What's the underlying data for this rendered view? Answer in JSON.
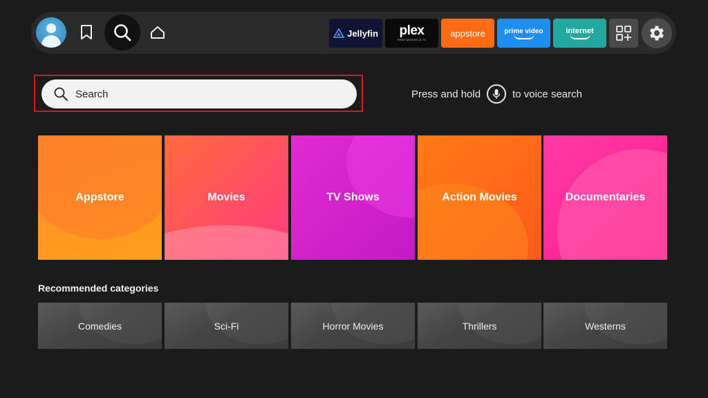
{
  "nav": {
    "profile_icon": "profile-avatar-icon",
    "watchlist_icon": "bookmark-icon",
    "search_icon": "search-icon",
    "home_icon": "home-icon"
  },
  "apps": {
    "jellyfin": "Jellyfin",
    "plex": "plex",
    "plex_sub": "FREE MOVIES & TV",
    "appstore": "appstore",
    "prime": "prime video",
    "internet": "internet",
    "apps_icon": "apps-grid-plus-icon",
    "settings_icon": "gear-icon"
  },
  "search": {
    "placeholder": "Search",
    "voice_hint_before": "Press and hold",
    "voice_hint_after": "to voice search",
    "focus_color": "#d51a1a"
  },
  "categories": [
    {
      "label": "Appstore",
      "color": "#ff8c2e"
    },
    {
      "label": "Movies",
      "color": "#ff4f6a"
    },
    {
      "label": "TV Shows",
      "color": "#d822cc"
    },
    {
      "label": "Action Movies",
      "color": "#ff6a16"
    },
    {
      "label": "Documentaries",
      "color": "#ff2a98"
    }
  ],
  "recommended": {
    "title": "Recommended categories",
    "items": [
      "Comedies",
      "Sci-Fi",
      "Horror Movies",
      "Thrillers",
      "Westerns"
    ]
  }
}
